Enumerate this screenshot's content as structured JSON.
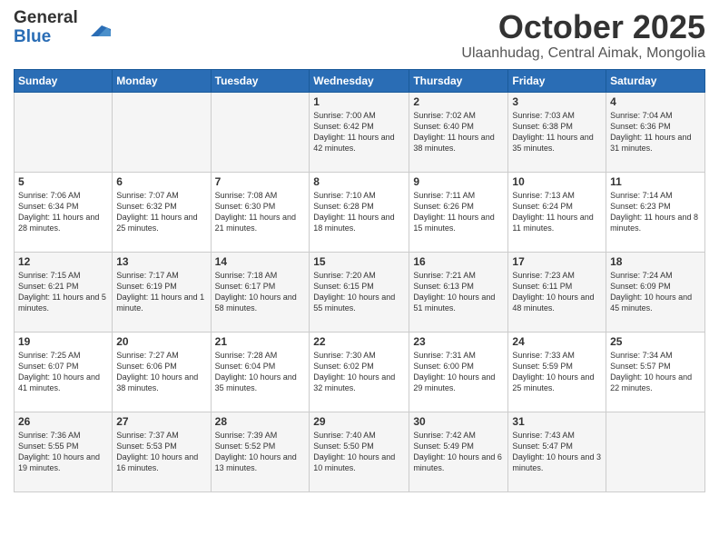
{
  "logo": {
    "general": "General",
    "blue": "Blue"
  },
  "header": {
    "month": "October 2025",
    "location": "Ulaanhudag, Central Aimak, Mongolia"
  },
  "weekdays": [
    "Sunday",
    "Monday",
    "Tuesday",
    "Wednesday",
    "Thursday",
    "Friday",
    "Saturday"
  ],
  "weeks": [
    [
      {
        "day": "",
        "sunrise": "",
        "sunset": "",
        "daylight": ""
      },
      {
        "day": "",
        "sunrise": "",
        "sunset": "",
        "daylight": ""
      },
      {
        "day": "",
        "sunrise": "",
        "sunset": "",
        "daylight": ""
      },
      {
        "day": "1",
        "sunrise": "Sunrise: 7:00 AM",
        "sunset": "Sunset: 6:42 PM",
        "daylight": "Daylight: 11 hours and 42 minutes."
      },
      {
        "day": "2",
        "sunrise": "Sunrise: 7:02 AM",
        "sunset": "Sunset: 6:40 PM",
        "daylight": "Daylight: 11 hours and 38 minutes."
      },
      {
        "day": "3",
        "sunrise": "Sunrise: 7:03 AM",
        "sunset": "Sunset: 6:38 PM",
        "daylight": "Daylight: 11 hours and 35 minutes."
      },
      {
        "day": "4",
        "sunrise": "Sunrise: 7:04 AM",
        "sunset": "Sunset: 6:36 PM",
        "daylight": "Daylight: 11 hours and 31 minutes."
      }
    ],
    [
      {
        "day": "5",
        "sunrise": "Sunrise: 7:06 AM",
        "sunset": "Sunset: 6:34 PM",
        "daylight": "Daylight: 11 hours and 28 minutes."
      },
      {
        "day": "6",
        "sunrise": "Sunrise: 7:07 AM",
        "sunset": "Sunset: 6:32 PM",
        "daylight": "Daylight: 11 hours and 25 minutes."
      },
      {
        "day": "7",
        "sunrise": "Sunrise: 7:08 AM",
        "sunset": "Sunset: 6:30 PM",
        "daylight": "Daylight: 11 hours and 21 minutes."
      },
      {
        "day": "8",
        "sunrise": "Sunrise: 7:10 AM",
        "sunset": "Sunset: 6:28 PM",
        "daylight": "Daylight: 11 hours and 18 minutes."
      },
      {
        "day": "9",
        "sunrise": "Sunrise: 7:11 AM",
        "sunset": "Sunset: 6:26 PM",
        "daylight": "Daylight: 11 hours and 15 minutes."
      },
      {
        "day": "10",
        "sunrise": "Sunrise: 7:13 AM",
        "sunset": "Sunset: 6:24 PM",
        "daylight": "Daylight: 11 hours and 11 minutes."
      },
      {
        "day": "11",
        "sunrise": "Sunrise: 7:14 AM",
        "sunset": "Sunset: 6:23 PM",
        "daylight": "Daylight: 11 hours and 8 minutes."
      }
    ],
    [
      {
        "day": "12",
        "sunrise": "Sunrise: 7:15 AM",
        "sunset": "Sunset: 6:21 PM",
        "daylight": "Daylight: 11 hours and 5 minutes."
      },
      {
        "day": "13",
        "sunrise": "Sunrise: 7:17 AM",
        "sunset": "Sunset: 6:19 PM",
        "daylight": "Daylight: 11 hours and 1 minute."
      },
      {
        "day": "14",
        "sunrise": "Sunrise: 7:18 AM",
        "sunset": "Sunset: 6:17 PM",
        "daylight": "Daylight: 10 hours and 58 minutes."
      },
      {
        "day": "15",
        "sunrise": "Sunrise: 7:20 AM",
        "sunset": "Sunset: 6:15 PM",
        "daylight": "Daylight: 10 hours and 55 minutes."
      },
      {
        "day": "16",
        "sunrise": "Sunrise: 7:21 AM",
        "sunset": "Sunset: 6:13 PM",
        "daylight": "Daylight: 10 hours and 51 minutes."
      },
      {
        "day": "17",
        "sunrise": "Sunrise: 7:23 AM",
        "sunset": "Sunset: 6:11 PM",
        "daylight": "Daylight: 10 hours and 48 minutes."
      },
      {
        "day": "18",
        "sunrise": "Sunrise: 7:24 AM",
        "sunset": "Sunset: 6:09 PM",
        "daylight": "Daylight: 10 hours and 45 minutes."
      }
    ],
    [
      {
        "day": "19",
        "sunrise": "Sunrise: 7:25 AM",
        "sunset": "Sunset: 6:07 PM",
        "daylight": "Daylight: 10 hours and 41 minutes."
      },
      {
        "day": "20",
        "sunrise": "Sunrise: 7:27 AM",
        "sunset": "Sunset: 6:06 PM",
        "daylight": "Daylight: 10 hours and 38 minutes."
      },
      {
        "day": "21",
        "sunrise": "Sunrise: 7:28 AM",
        "sunset": "Sunset: 6:04 PM",
        "daylight": "Daylight: 10 hours and 35 minutes."
      },
      {
        "day": "22",
        "sunrise": "Sunrise: 7:30 AM",
        "sunset": "Sunset: 6:02 PM",
        "daylight": "Daylight: 10 hours and 32 minutes."
      },
      {
        "day": "23",
        "sunrise": "Sunrise: 7:31 AM",
        "sunset": "Sunset: 6:00 PM",
        "daylight": "Daylight: 10 hours and 29 minutes."
      },
      {
        "day": "24",
        "sunrise": "Sunrise: 7:33 AM",
        "sunset": "Sunset: 5:59 PM",
        "daylight": "Daylight: 10 hours and 25 minutes."
      },
      {
        "day": "25",
        "sunrise": "Sunrise: 7:34 AM",
        "sunset": "Sunset: 5:57 PM",
        "daylight": "Daylight: 10 hours and 22 minutes."
      }
    ],
    [
      {
        "day": "26",
        "sunrise": "Sunrise: 7:36 AM",
        "sunset": "Sunset: 5:55 PM",
        "daylight": "Daylight: 10 hours and 19 minutes."
      },
      {
        "day": "27",
        "sunrise": "Sunrise: 7:37 AM",
        "sunset": "Sunset: 5:53 PM",
        "daylight": "Daylight: 10 hours and 16 minutes."
      },
      {
        "day": "28",
        "sunrise": "Sunrise: 7:39 AM",
        "sunset": "Sunset: 5:52 PM",
        "daylight": "Daylight: 10 hours and 13 minutes."
      },
      {
        "day": "29",
        "sunrise": "Sunrise: 7:40 AM",
        "sunset": "Sunset: 5:50 PM",
        "daylight": "Daylight: 10 hours and 10 minutes."
      },
      {
        "day": "30",
        "sunrise": "Sunrise: 7:42 AM",
        "sunset": "Sunset: 5:49 PM",
        "daylight": "Daylight: 10 hours and 6 minutes."
      },
      {
        "day": "31",
        "sunrise": "Sunrise: 7:43 AM",
        "sunset": "Sunset: 5:47 PM",
        "daylight": "Daylight: 10 hours and 3 minutes."
      },
      {
        "day": "",
        "sunrise": "",
        "sunset": "",
        "daylight": ""
      }
    ]
  ]
}
